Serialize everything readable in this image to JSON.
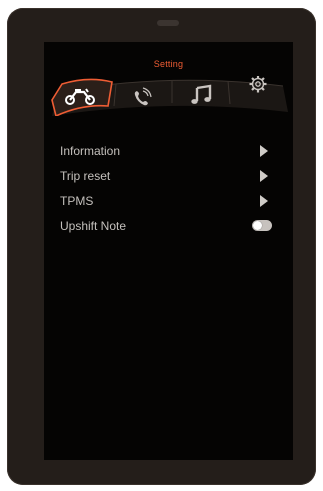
{
  "header": {
    "title": "Setting"
  },
  "tabs": [
    {
      "icon": "motorcycle-icon",
      "active": true
    },
    {
      "icon": "phone-icon",
      "active": false
    },
    {
      "icon": "music-note-icon",
      "active": false
    },
    {
      "icon": "gear-icon",
      "active": false
    }
  ],
  "menu": {
    "items": [
      {
        "label": "Information",
        "control": "arrow"
      },
      {
        "label": "Trip reset",
        "control": "arrow"
      },
      {
        "label": "TPMS",
        "control": "arrow"
      },
      {
        "label": "Upshift Note",
        "control": "toggle",
        "toggle_on": false
      }
    ]
  },
  "colors": {
    "accent": "#ef5d34",
    "text": "#c4c0bc",
    "bezel": "#241e1a",
    "screen": "#050403"
  }
}
